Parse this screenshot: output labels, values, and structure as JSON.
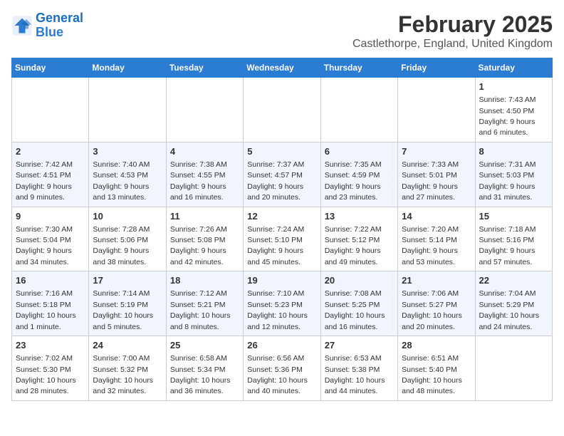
{
  "header": {
    "logo_line1": "General",
    "logo_line2": "Blue",
    "month": "February 2025",
    "location": "Castlethorpe, England, United Kingdom"
  },
  "weekdays": [
    "Sunday",
    "Monday",
    "Tuesday",
    "Wednesday",
    "Thursday",
    "Friday",
    "Saturday"
  ],
  "weeks": [
    [
      {
        "day": "",
        "info": ""
      },
      {
        "day": "",
        "info": ""
      },
      {
        "day": "",
        "info": ""
      },
      {
        "day": "",
        "info": ""
      },
      {
        "day": "",
        "info": ""
      },
      {
        "day": "",
        "info": ""
      },
      {
        "day": "1",
        "info": "Sunrise: 7:43 AM\nSunset: 4:50 PM\nDaylight: 9 hours and 6 minutes."
      }
    ],
    [
      {
        "day": "2",
        "info": "Sunrise: 7:42 AM\nSunset: 4:51 PM\nDaylight: 9 hours and 9 minutes."
      },
      {
        "day": "3",
        "info": "Sunrise: 7:40 AM\nSunset: 4:53 PM\nDaylight: 9 hours and 13 minutes."
      },
      {
        "day": "4",
        "info": "Sunrise: 7:38 AM\nSunset: 4:55 PM\nDaylight: 9 hours and 16 minutes."
      },
      {
        "day": "5",
        "info": "Sunrise: 7:37 AM\nSunset: 4:57 PM\nDaylight: 9 hours and 20 minutes."
      },
      {
        "day": "6",
        "info": "Sunrise: 7:35 AM\nSunset: 4:59 PM\nDaylight: 9 hours and 23 minutes."
      },
      {
        "day": "7",
        "info": "Sunrise: 7:33 AM\nSunset: 5:01 PM\nDaylight: 9 hours and 27 minutes."
      },
      {
        "day": "8",
        "info": "Sunrise: 7:31 AM\nSunset: 5:03 PM\nDaylight: 9 hours and 31 minutes."
      }
    ],
    [
      {
        "day": "9",
        "info": "Sunrise: 7:30 AM\nSunset: 5:04 PM\nDaylight: 9 hours and 34 minutes."
      },
      {
        "day": "10",
        "info": "Sunrise: 7:28 AM\nSunset: 5:06 PM\nDaylight: 9 hours and 38 minutes."
      },
      {
        "day": "11",
        "info": "Sunrise: 7:26 AM\nSunset: 5:08 PM\nDaylight: 9 hours and 42 minutes."
      },
      {
        "day": "12",
        "info": "Sunrise: 7:24 AM\nSunset: 5:10 PM\nDaylight: 9 hours and 45 minutes."
      },
      {
        "day": "13",
        "info": "Sunrise: 7:22 AM\nSunset: 5:12 PM\nDaylight: 9 hours and 49 minutes."
      },
      {
        "day": "14",
        "info": "Sunrise: 7:20 AM\nSunset: 5:14 PM\nDaylight: 9 hours and 53 minutes."
      },
      {
        "day": "15",
        "info": "Sunrise: 7:18 AM\nSunset: 5:16 PM\nDaylight: 9 hours and 57 minutes."
      }
    ],
    [
      {
        "day": "16",
        "info": "Sunrise: 7:16 AM\nSunset: 5:18 PM\nDaylight: 10 hours and 1 minute."
      },
      {
        "day": "17",
        "info": "Sunrise: 7:14 AM\nSunset: 5:19 PM\nDaylight: 10 hours and 5 minutes."
      },
      {
        "day": "18",
        "info": "Sunrise: 7:12 AM\nSunset: 5:21 PM\nDaylight: 10 hours and 8 minutes."
      },
      {
        "day": "19",
        "info": "Sunrise: 7:10 AM\nSunset: 5:23 PM\nDaylight: 10 hours and 12 minutes."
      },
      {
        "day": "20",
        "info": "Sunrise: 7:08 AM\nSunset: 5:25 PM\nDaylight: 10 hours and 16 minutes."
      },
      {
        "day": "21",
        "info": "Sunrise: 7:06 AM\nSunset: 5:27 PM\nDaylight: 10 hours and 20 minutes."
      },
      {
        "day": "22",
        "info": "Sunrise: 7:04 AM\nSunset: 5:29 PM\nDaylight: 10 hours and 24 minutes."
      }
    ],
    [
      {
        "day": "23",
        "info": "Sunrise: 7:02 AM\nSunset: 5:30 PM\nDaylight: 10 hours and 28 minutes."
      },
      {
        "day": "24",
        "info": "Sunrise: 7:00 AM\nSunset: 5:32 PM\nDaylight: 10 hours and 32 minutes."
      },
      {
        "day": "25",
        "info": "Sunrise: 6:58 AM\nSunset: 5:34 PM\nDaylight: 10 hours and 36 minutes."
      },
      {
        "day": "26",
        "info": "Sunrise: 6:56 AM\nSunset: 5:36 PM\nDaylight: 10 hours and 40 minutes."
      },
      {
        "day": "27",
        "info": "Sunrise: 6:53 AM\nSunset: 5:38 PM\nDaylight: 10 hours and 44 minutes."
      },
      {
        "day": "28",
        "info": "Sunrise: 6:51 AM\nSunset: 5:40 PM\nDaylight: 10 hours and 48 minutes."
      },
      {
        "day": "",
        "info": ""
      }
    ]
  ]
}
